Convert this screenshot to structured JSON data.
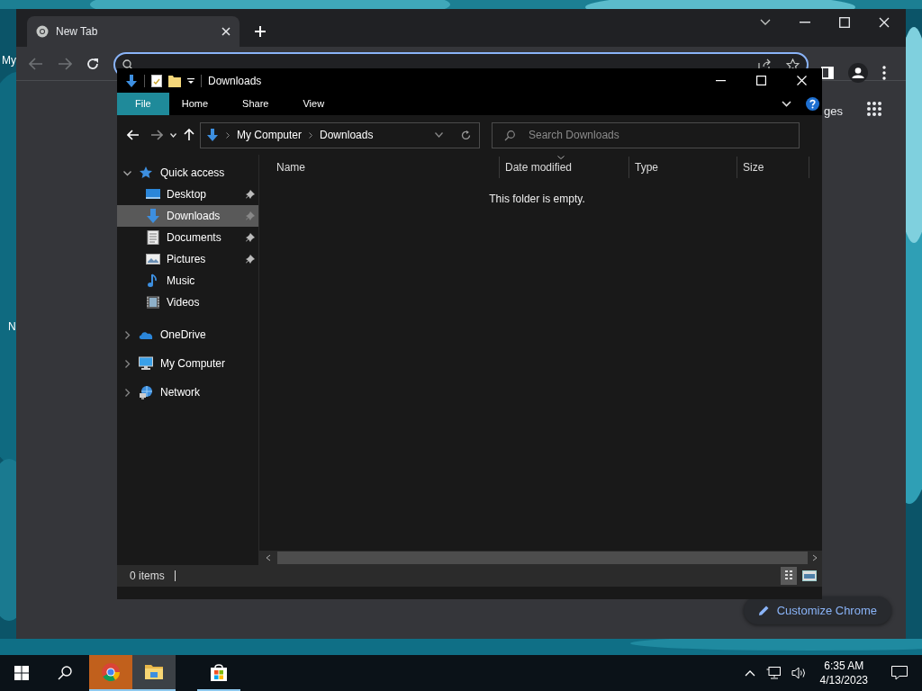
{
  "desktop": {
    "icon_labels": [
      "My",
      "N"
    ]
  },
  "browser": {
    "tabs": [
      {
        "label": "New Tab",
        "selected": true
      }
    ],
    "partial_link": "ges",
    "customize_button": "Customize Chrome"
  },
  "explorer": {
    "title": "Downloads",
    "ribbon_tabs": [
      {
        "label": "File",
        "selected": true
      },
      {
        "label": "Home",
        "selected": false
      },
      {
        "label": "Share",
        "selected": false
      },
      {
        "label": "View",
        "selected": false
      }
    ],
    "breadcrumb": [
      "My Computer",
      "Downloads"
    ],
    "search": {
      "placeholder": "Search Downloads"
    },
    "nav": [
      {
        "label": "Quick access",
        "kind": "star",
        "expanded": true,
        "selected": false,
        "children": [
          {
            "label": "Desktop",
            "kind": "desktop",
            "pinned": true,
            "selected": false
          },
          {
            "label": "Downloads",
            "kind": "download",
            "pinned": true,
            "selected": true
          },
          {
            "label": "Documents",
            "kind": "document",
            "pinned": true,
            "selected": false
          },
          {
            "label": "Pictures",
            "kind": "pictures",
            "pinned": true,
            "selected": false
          },
          {
            "label": "Music",
            "kind": "music",
            "pinned": false,
            "selected": false
          },
          {
            "label": "Videos",
            "kind": "videos",
            "pinned": false,
            "selected": false
          }
        ]
      },
      {
        "label": "OneDrive",
        "kind": "cloud",
        "expanded": false,
        "selected": false
      },
      {
        "label": "My Computer",
        "kind": "computer",
        "expanded": false,
        "selected": false
      },
      {
        "label": "Network",
        "kind": "network",
        "expanded": false,
        "selected": false
      }
    ],
    "columns": [
      "Name",
      "Date modified",
      "Type",
      "Size"
    ],
    "empty_message": "This folder is empty.",
    "status": "0 items"
  },
  "taskbar": {
    "apps": [
      {
        "kind": "chrome",
        "flashing": true,
        "active": false
      },
      {
        "kind": "folder",
        "flashing": false,
        "active": true
      },
      {
        "kind": "store",
        "flashing": false,
        "active": false
      }
    ],
    "time": "6:35 AM",
    "date": "4/13/2023"
  }
}
